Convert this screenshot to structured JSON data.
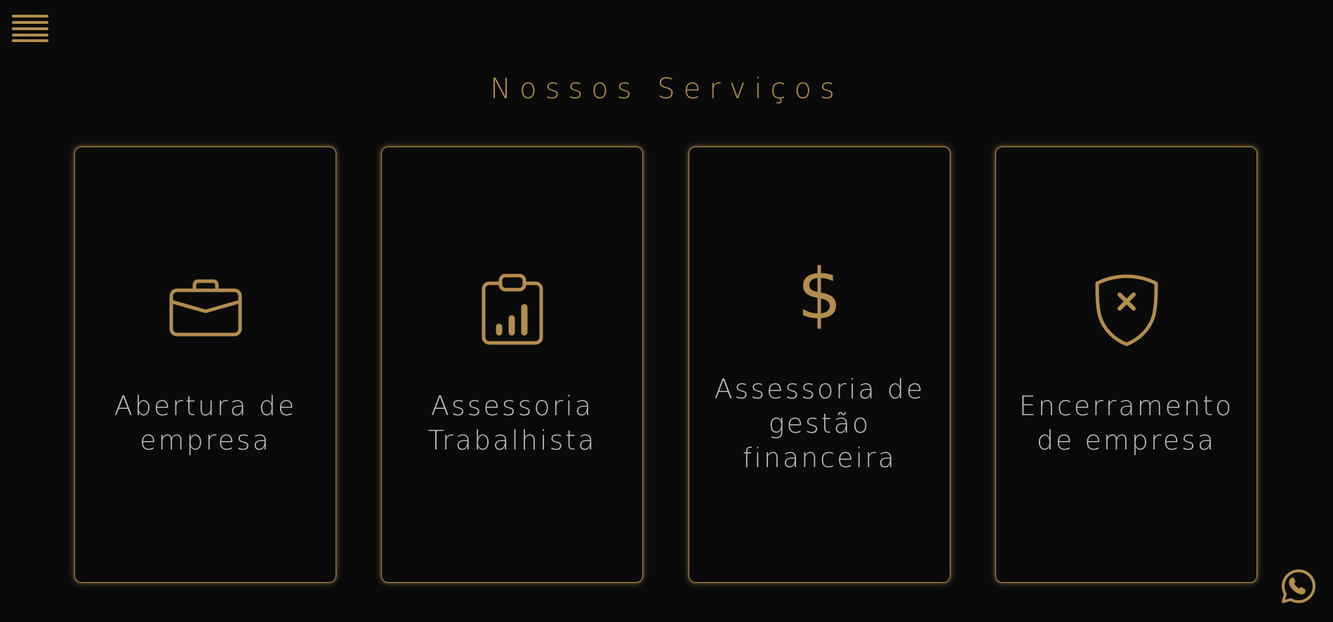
{
  "colors": {
    "background": "#0a0a0a",
    "accent": "#b38d4e",
    "text": "#bdbdbd"
  },
  "header": {
    "menu_icon": "hamburger-menu-icon"
  },
  "services": {
    "title": "Nossos Serviços",
    "cards": [
      {
        "icon": "briefcase-icon",
        "label": "Abertura de\nempresa"
      },
      {
        "icon": "clipboard-chart-icon",
        "label": "Assessoria\nTrabalhista"
      },
      {
        "icon": "dollar-icon",
        "icon_glyph": "$",
        "label": "Assessoria de\ngestão\nfinanceira"
      },
      {
        "icon": "shield-x-icon",
        "label": "Encerramento\nde empresa"
      }
    ]
  },
  "floating": {
    "whatsapp_icon": "whatsapp-icon"
  }
}
